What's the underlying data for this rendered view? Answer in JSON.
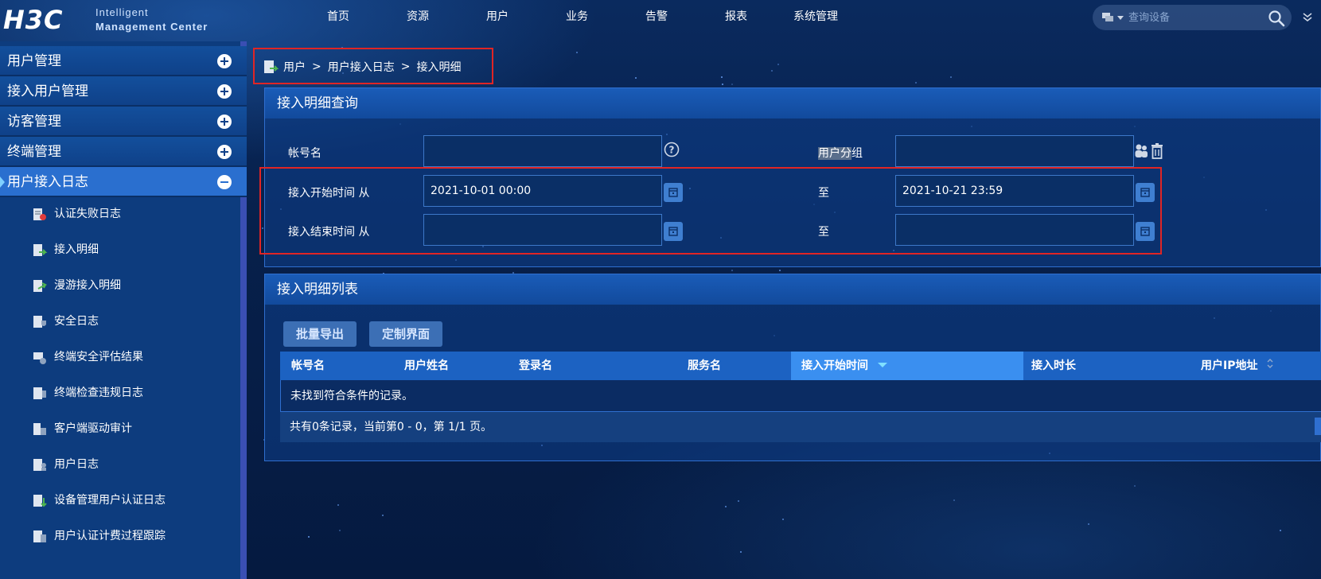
{
  "logo": {
    "brand": "H3C",
    "line1": "Intelligent",
    "line2": "Management Center"
  },
  "nav": [
    "首页",
    "资源",
    "用户",
    "业务",
    "告警",
    "报表",
    "系统管理"
  ],
  "top_search": {
    "placeholder": "查询设备"
  },
  "sidebar": {
    "groups": [
      {
        "label": "用户管理",
        "expanded": false
      },
      {
        "label": "接入用户管理",
        "expanded": false
      },
      {
        "label": "访客管理",
        "expanded": false
      },
      {
        "label": "终端管理",
        "expanded": false
      },
      {
        "label": "用户接入日志",
        "expanded": true
      }
    ],
    "sub_items": [
      {
        "label": "认证失败日志",
        "icon": "auth-fail-log-icon"
      },
      {
        "label": "接入明细",
        "icon": "access-detail-icon"
      },
      {
        "label": "漫游接入明细",
        "icon": "roaming-detail-icon"
      },
      {
        "label": "安全日志",
        "icon": "security-log-icon"
      },
      {
        "label": "终端安全评估结果",
        "icon": "terminal-assess-icon"
      },
      {
        "label": "终端检查违规日志",
        "icon": "terminal-violation-icon"
      },
      {
        "label": "客户端驱动审计",
        "icon": "client-driver-icon"
      },
      {
        "label": "用户日志",
        "icon": "user-log-icon"
      },
      {
        "label": "设备管理用户认证日志",
        "icon": "device-auth-log-icon"
      },
      {
        "label": "用户认证计费过程跟踪",
        "icon": "auth-trace-icon"
      }
    ]
  },
  "breadcrumb": [
    "用户",
    "用户接入日志",
    "接入明细"
  ],
  "breadcrumb_sep": ">",
  "query": {
    "title": "接入明细查询",
    "account_label": "帐号名",
    "account_value": "",
    "group_label_hl": "用户分",
    "group_label_rest": "组",
    "group_value": "",
    "start_label": "接入开始时间 从",
    "start_from": "2021-10-01 00:00",
    "start_to_label": "至",
    "start_to": "2021-10-21 23:59",
    "end_label": "接入结束时间 从",
    "end_from": "",
    "end_to_label": "至",
    "end_to": ""
  },
  "list": {
    "title": "接入明细列表",
    "export_button": "批量导出",
    "customize_button": "定制界面",
    "columns": [
      "帐号名",
      "用户姓名",
      "登录名",
      "服务名",
      "接入开始时间",
      "接入时长",
      "用户IP地址"
    ],
    "sorted_column": "接入开始时间",
    "empty_text": "未找到符合条件的记录。",
    "footer_text": "共有0条记录，当前第0 - 0，第 1/1 页。"
  }
}
